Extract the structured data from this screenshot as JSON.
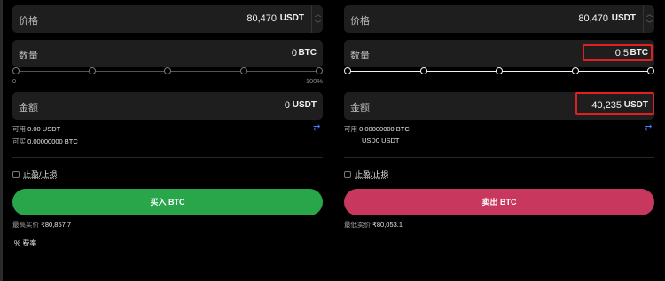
{
  "buy": {
    "price_label": "价格",
    "price_value": "80,470",
    "price_unit": "USDT",
    "qty_label": "数量",
    "qty_value": "0",
    "qty_unit": "BTC",
    "slider_min": "0",
    "slider_max": "100%",
    "slider_level_percent": 0,
    "amount_label": "金额",
    "amount_value": "0",
    "amount_unit": "USDT",
    "available_label": "可用",
    "available_value": "0.00 USDT",
    "can_buy_label": "可买",
    "can_buy_value": "0.00000000 BTC",
    "tpsl_label": "止盈/止损",
    "button_label": "买入 BTC",
    "best_label": "最高买价",
    "best_value": "₹80,857.7",
    "fee_label": "% 费率"
  },
  "sell": {
    "price_label": "价格",
    "price_value": "80,470",
    "price_unit": "USDT",
    "qty_label": "数量",
    "qty_value": "0.5",
    "qty_unit": "BTC",
    "slider_level_percent": 0,
    "amount_label": "金额",
    "amount_value": "40,235",
    "amount_unit": "USDT",
    "available_label": "可用",
    "available_value": "0.00000000 BTC",
    "sub_value": "USD0 USDT",
    "tpsl_label": "止盈/止损",
    "button_label": "卖出 BTC",
    "best_label": "最低卖价",
    "best_value": "₹80,053.1"
  },
  "icons": {
    "spinner_up": "chevron-up-icon",
    "spinner_down": "chevron-down-icon",
    "swap": "swap-arrows-icon"
  },
  "colors": {
    "buy_button": "#2aa64a",
    "sell_button": "#c8385e",
    "highlight": "#e02020",
    "swap_icon": "#4a7bff"
  }
}
